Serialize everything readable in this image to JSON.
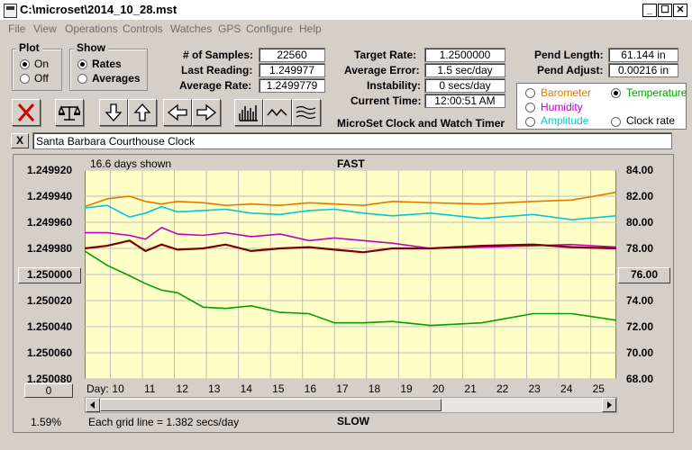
{
  "window": {
    "title": "C:\\microset\\2014_10_28.mst",
    "min": "_",
    "max": "☐",
    "close": "✕"
  },
  "menu": [
    "File",
    "View",
    "Operations",
    "Controls",
    "Watches",
    "GPS",
    "Configure",
    "Help"
  ],
  "plot": {
    "label": "Plot",
    "options": [
      "On",
      "Off"
    ],
    "selected": "On"
  },
  "show": {
    "label": "Show",
    "options": [
      "Rates",
      "Averages"
    ],
    "selected": "Rates"
  },
  "stats": {
    "samples_label": "# of Samples:",
    "samples": "22560",
    "last_reading_label": "Last Reading:",
    "last_reading": "1.249977",
    "average_rate_label": "Average Rate:",
    "average_rate": "1.2499779",
    "target_rate_label": "Target Rate:",
    "target_rate": "1.2500000",
    "average_error_label": "Average Error:",
    "average_error": "1.5 sec/day",
    "instability_label": "Instability:",
    "instability": "0 secs/day",
    "current_time_label": "Current Time:",
    "current_time": "12:00:51 AM",
    "pend_length_label": "Pend Length:",
    "pend_length": "61.144 in",
    "pend_adjust_label": "Pend Adjust:",
    "pend_adjust": "0.00216 in"
  },
  "app_name": "MicroSet Clock and Watch Timer",
  "sensors": [
    {
      "name": "Barometer",
      "color": "#e07a00",
      "selected": false
    },
    {
      "name": "Temperature",
      "color": "#00a000",
      "selected": true
    },
    {
      "name": "Humidity",
      "color": "#c000c0",
      "selected": false
    },
    {
      "name": "Clock rate",
      "color": "#000000",
      "selected": false
    },
    {
      "name": "Amplitude",
      "color": "#00c8d8",
      "selected": false
    }
  ],
  "toolbar_icons": [
    "close-x-icon",
    "balance-scale-icon",
    "arrow-down-icon",
    "arrow-up-icon",
    "arrow-left-icon",
    "arrow-right-icon",
    "histogram-icon",
    "wave-icon",
    "multi-wave-icon"
  ],
  "description_close": "X",
  "description": "Santa Barbara Courthouse Clock",
  "chart_data": {
    "type": "line",
    "top_label": "FAST",
    "bottom_label": "SLOW",
    "span_note": "16.6 days shown",
    "grid_note": "Each grid line = 1.382 secs/day",
    "percent": "1.59%",
    "x_prefix": "Day:",
    "x_ticks": [
      "10",
      "11",
      "12",
      "13",
      "14",
      "15",
      "16",
      "17",
      "18",
      "19",
      "20",
      "21",
      "22",
      "23",
      "24",
      "25"
    ],
    "x_tick_values": [
      10,
      11,
      12,
      13,
      14,
      15,
      16,
      17,
      18,
      19,
      20,
      21,
      22,
      23,
      24,
      25
    ],
    "x_range": [
      9.2,
      25.8
    ],
    "y_left_ticks": [
      "1.249920",
      "1.249940",
      "1.249960",
      "1.249980",
      "1.250000",
      "1.250020",
      "1.250040",
      "1.250060",
      "1.250080"
    ],
    "y_left_range": [
      1.24992,
      1.25008
    ],
    "y_left_center_button": "1.250000",
    "y_right_ticks": [
      "84.00",
      "82.00",
      "80.00",
      "78.00",
      "76.00",
      "74.00",
      "72.00",
      "70.00",
      "68.00"
    ],
    "y_right_range": [
      84,
      68
    ],
    "y_right_center_button": "76.00",
    "left_bottom_button": "0",
    "series": [
      {
        "color": "#e07a00",
        "y_right": [
          81.2,
          81.8,
          82.0,
          81.6,
          81.4,
          81.6,
          81.5,
          81.3,
          81.4,
          81.3,
          81.5,
          81.4,
          81.3,
          81.6,
          81.5,
          81.4,
          81.6,
          81.7,
          82.3
        ]
      },
      {
        "color": "#00c8d8",
        "y_right": [
          81.1,
          81.3,
          80.4,
          80.7,
          81.2,
          80.8,
          80.9,
          81.0,
          80.7,
          80.6,
          80.9,
          81.0,
          80.7,
          80.5,
          80.7,
          80.3,
          80.6,
          80.2,
          80.5
        ]
      },
      {
        "color": "#c000c0",
        "y_right": [
          79.2,
          79.2,
          79.0,
          78.7,
          79.6,
          79.1,
          79.0,
          79.2,
          78.9,
          79.1,
          78.6,
          78.8,
          78.6,
          78.4,
          78.0,
          78.1,
          78.2,
          78.3,
          78.1
        ]
      },
      {
        "color": "#7a0000",
        "y_right": [
          78.0,
          78.2,
          78.6,
          77.8,
          78.3,
          77.9,
          78.0,
          78.3,
          77.8,
          78.0,
          78.1,
          77.9,
          77.7,
          78.0,
          78.0,
          78.2,
          78.3,
          78.1,
          78.0
        ]
      },
      {
        "color": "#00a000",
        "y_right": [
          77.8,
          76.7,
          75.9,
          75.3,
          74.8,
          74.6,
          73.5,
          73.4,
          73.6,
          73.1,
          73.0,
          72.3,
          72.3,
          72.4,
          72.1,
          72.3,
          73.0,
          73.0,
          72.5
        ]
      }
    ],
    "series_x": [
      9.2,
      9.9,
      10.6,
      11.1,
      11.6,
      12.1,
      12.9,
      13.6,
      14.4,
      15.3,
      16.2,
      17.0,
      17.9,
      18.8,
      20.0,
      21.6,
      23.2,
      24.4,
      25.8
    ]
  }
}
